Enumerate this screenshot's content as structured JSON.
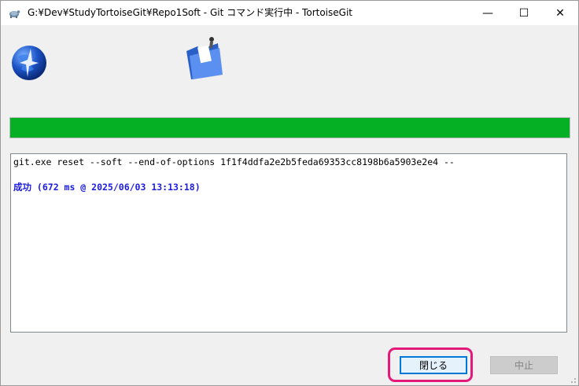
{
  "window": {
    "title": "G:¥Dev¥StudyTortoiseGit¥Repo1Soft - Git コマンド実行中 - TortoiseGit",
    "minimize_glyph": "—",
    "maximize_glyph": "☐",
    "close_glyph": "✕"
  },
  "icons": {
    "app": "tortoisegit-app-icon",
    "logo": "globe-icon",
    "folder": "folder-icon"
  },
  "progress": {
    "value": 1.0,
    "color": "#06b025"
  },
  "log": {
    "lines": [
      {
        "text": "git.exe reset --soft --end-of-options 1f1f4ddfa2e2b5feda69353cc8198b6a5903e2e4 --",
        "style": "normal"
      },
      {
        "text": "",
        "style": "normal"
      },
      {
        "text": "成功 (672 ms @ 2025/06/03 13:13:18)",
        "style": "success"
      }
    ]
  },
  "buttons": {
    "close_label": "閉じる",
    "abort_label": "中止"
  },
  "colors": {
    "success_text": "#1b1be0",
    "highlight": "#e5197a",
    "focus_border": "#0078d7"
  }
}
